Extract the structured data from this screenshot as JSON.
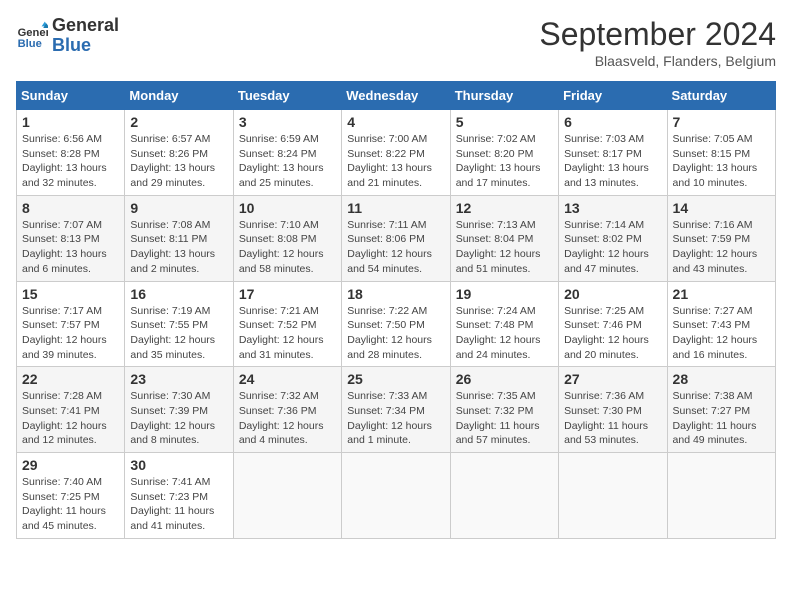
{
  "header": {
    "logo_line1": "General",
    "logo_line2": "Blue",
    "month_title": "September 2024",
    "subtitle": "Blaasveld, Flanders, Belgium"
  },
  "weekdays": [
    "Sunday",
    "Monday",
    "Tuesday",
    "Wednesday",
    "Thursday",
    "Friday",
    "Saturday"
  ],
  "weeks": [
    [
      {
        "day": "1",
        "sunrise": "Sunrise: 6:56 AM",
        "sunset": "Sunset: 8:28 PM",
        "daylight": "Daylight: 13 hours and 32 minutes."
      },
      {
        "day": "2",
        "sunrise": "Sunrise: 6:57 AM",
        "sunset": "Sunset: 8:26 PM",
        "daylight": "Daylight: 13 hours and 29 minutes."
      },
      {
        "day": "3",
        "sunrise": "Sunrise: 6:59 AM",
        "sunset": "Sunset: 8:24 PM",
        "daylight": "Daylight: 13 hours and 25 minutes."
      },
      {
        "day": "4",
        "sunrise": "Sunrise: 7:00 AM",
        "sunset": "Sunset: 8:22 PM",
        "daylight": "Daylight: 13 hours and 21 minutes."
      },
      {
        "day": "5",
        "sunrise": "Sunrise: 7:02 AM",
        "sunset": "Sunset: 8:20 PM",
        "daylight": "Daylight: 13 hours and 17 minutes."
      },
      {
        "day": "6",
        "sunrise": "Sunrise: 7:03 AM",
        "sunset": "Sunset: 8:17 PM",
        "daylight": "Daylight: 13 hours and 13 minutes."
      },
      {
        "day": "7",
        "sunrise": "Sunrise: 7:05 AM",
        "sunset": "Sunset: 8:15 PM",
        "daylight": "Daylight: 13 hours and 10 minutes."
      }
    ],
    [
      {
        "day": "8",
        "sunrise": "Sunrise: 7:07 AM",
        "sunset": "Sunset: 8:13 PM",
        "daylight": "Daylight: 13 hours and 6 minutes."
      },
      {
        "day": "9",
        "sunrise": "Sunrise: 7:08 AM",
        "sunset": "Sunset: 8:11 PM",
        "daylight": "Daylight: 13 hours and 2 minutes."
      },
      {
        "day": "10",
        "sunrise": "Sunrise: 7:10 AM",
        "sunset": "Sunset: 8:08 PM",
        "daylight": "Daylight: 12 hours and 58 minutes."
      },
      {
        "day": "11",
        "sunrise": "Sunrise: 7:11 AM",
        "sunset": "Sunset: 8:06 PM",
        "daylight": "Daylight: 12 hours and 54 minutes."
      },
      {
        "day": "12",
        "sunrise": "Sunrise: 7:13 AM",
        "sunset": "Sunset: 8:04 PM",
        "daylight": "Daylight: 12 hours and 51 minutes."
      },
      {
        "day": "13",
        "sunrise": "Sunrise: 7:14 AM",
        "sunset": "Sunset: 8:02 PM",
        "daylight": "Daylight: 12 hours and 47 minutes."
      },
      {
        "day": "14",
        "sunrise": "Sunrise: 7:16 AM",
        "sunset": "Sunset: 7:59 PM",
        "daylight": "Daylight: 12 hours and 43 minutes."
      }
    ],
    [
      {
        "day": "15",
        "sunrise": "Sunrise: 7:17 AM",
        "sunset": "Sunset: 7:57 PM",
        "daylight": "Daylight: 12 hours and 39 minutes."
      },
      {
        "day": "16",
        "sunrise": "Sunrise: 7:19 AM",
        "sunset": "Sunset: 7:55 PM",
        "daylight": "Daylight: 12 hours and 35 minutes."
      },
      {
        "day": "17",
        "sunrise": "Sunrise: 7:21 AM",
        "sunset": "Sunset: 7:52 PM",
        "daylight": "Daylight: 12 hours and 31 minutes."
      },
      {
        "day": "18",
        "sunrise": "Sunrise: 7:22 AM",
        "sunset": "Sunset: 7:50 PM",
        "daylight": "Daylight: 12 hours and 28 minutes."
      },
      {
        "day": "19",
        "sunrise": "Sunrise: 7:24 AM",
        "sunset": "Sunset: 7:48 PM",
        "daylight": "Daylight: 12 hours and 24 minutes."
      },
      {
        "day": "20",
        "sunrise": "Sunrise: 7:25 AM",
        "sunset": "Sunset: 7:46 PM",
        "daylight": "Daylight: 12 hours and 20 minutes."
      },
      {
        "day": "21",
        "sunrise": "Sunrise: 7:27 AM",
        "sunset": "Sunset: 7:43 PM",
        "daylight": "Daylight: 12 hours and 16 minutes."
      }
    ],
    [
      {
        "day": "22",
        "sunrise": "Sunrise: 7:28 AM",
        "sunset": "Sunset: 7:41 PM",
        "daylight": "Daylight: 12 hours and 12 minutes."
      },
      {
        "day": "23",
        "sunrise": "Sunrise: 7:30 AM",
        "sunset": "Sunset: 7:39 PM",
        "daylight": "Daylight: 12 hours and 8 minutes."
      },
      {
        "day": "24",
        "sunrise": "Sunrise: 7:32 AM",
        "sunset": "Sunset: 7:36 PM",
        "daylight": "Daylight: 12 hours and 4 minutes."
      },
      {
        "day": "25",
        "sunrise": "Sunrise: 7:33 AM",
        "sunset": "Sunset: 7:34 PM",
        "daylight": "Daylight: 12 hours and 1 minute."
      },
      {
        "day": "26",
        "sunrise": "Sunrise: 7:35 AM",
        "sunset": "Sunset: 7:32 PM",
        "daylight": "Daylight: 11 hours and 57 minutes."
      },
      {
        "day": "27",
        "sunrise": "Sunrise: 7:36 AM",
        "sunset": "Sunset: 7:30 PM",
        "daylight": "Daylight: 11 hours and 53 minutes."
      },
      {
        "day": "28",
        "sunrise": "Sunrise: 7:38 AM",
        "sunset": "Sunset: 7:27 PM",
        "daylight": "Daylight: 11 hours and 49 minutes."
      }
    ],
    [
      {
        "day": "29",
        "sunrise": "Sunrise: 7:40 AM",
        "sunset": "Sunset: 7:25 PM",
        "daylight": "Daylight: 11 hours and 45 minutes."
      },
      {
        "day": "30",
        "sunrise": "Sunrise: 7:41 AM",
        "sunset": "Sunset: 7:23 PM",
        "daylight": "Daylight: 11 hours and 41 minutes."
      },
      null,
      null,
      null,
      null,
      null
    ]
  ]
}
